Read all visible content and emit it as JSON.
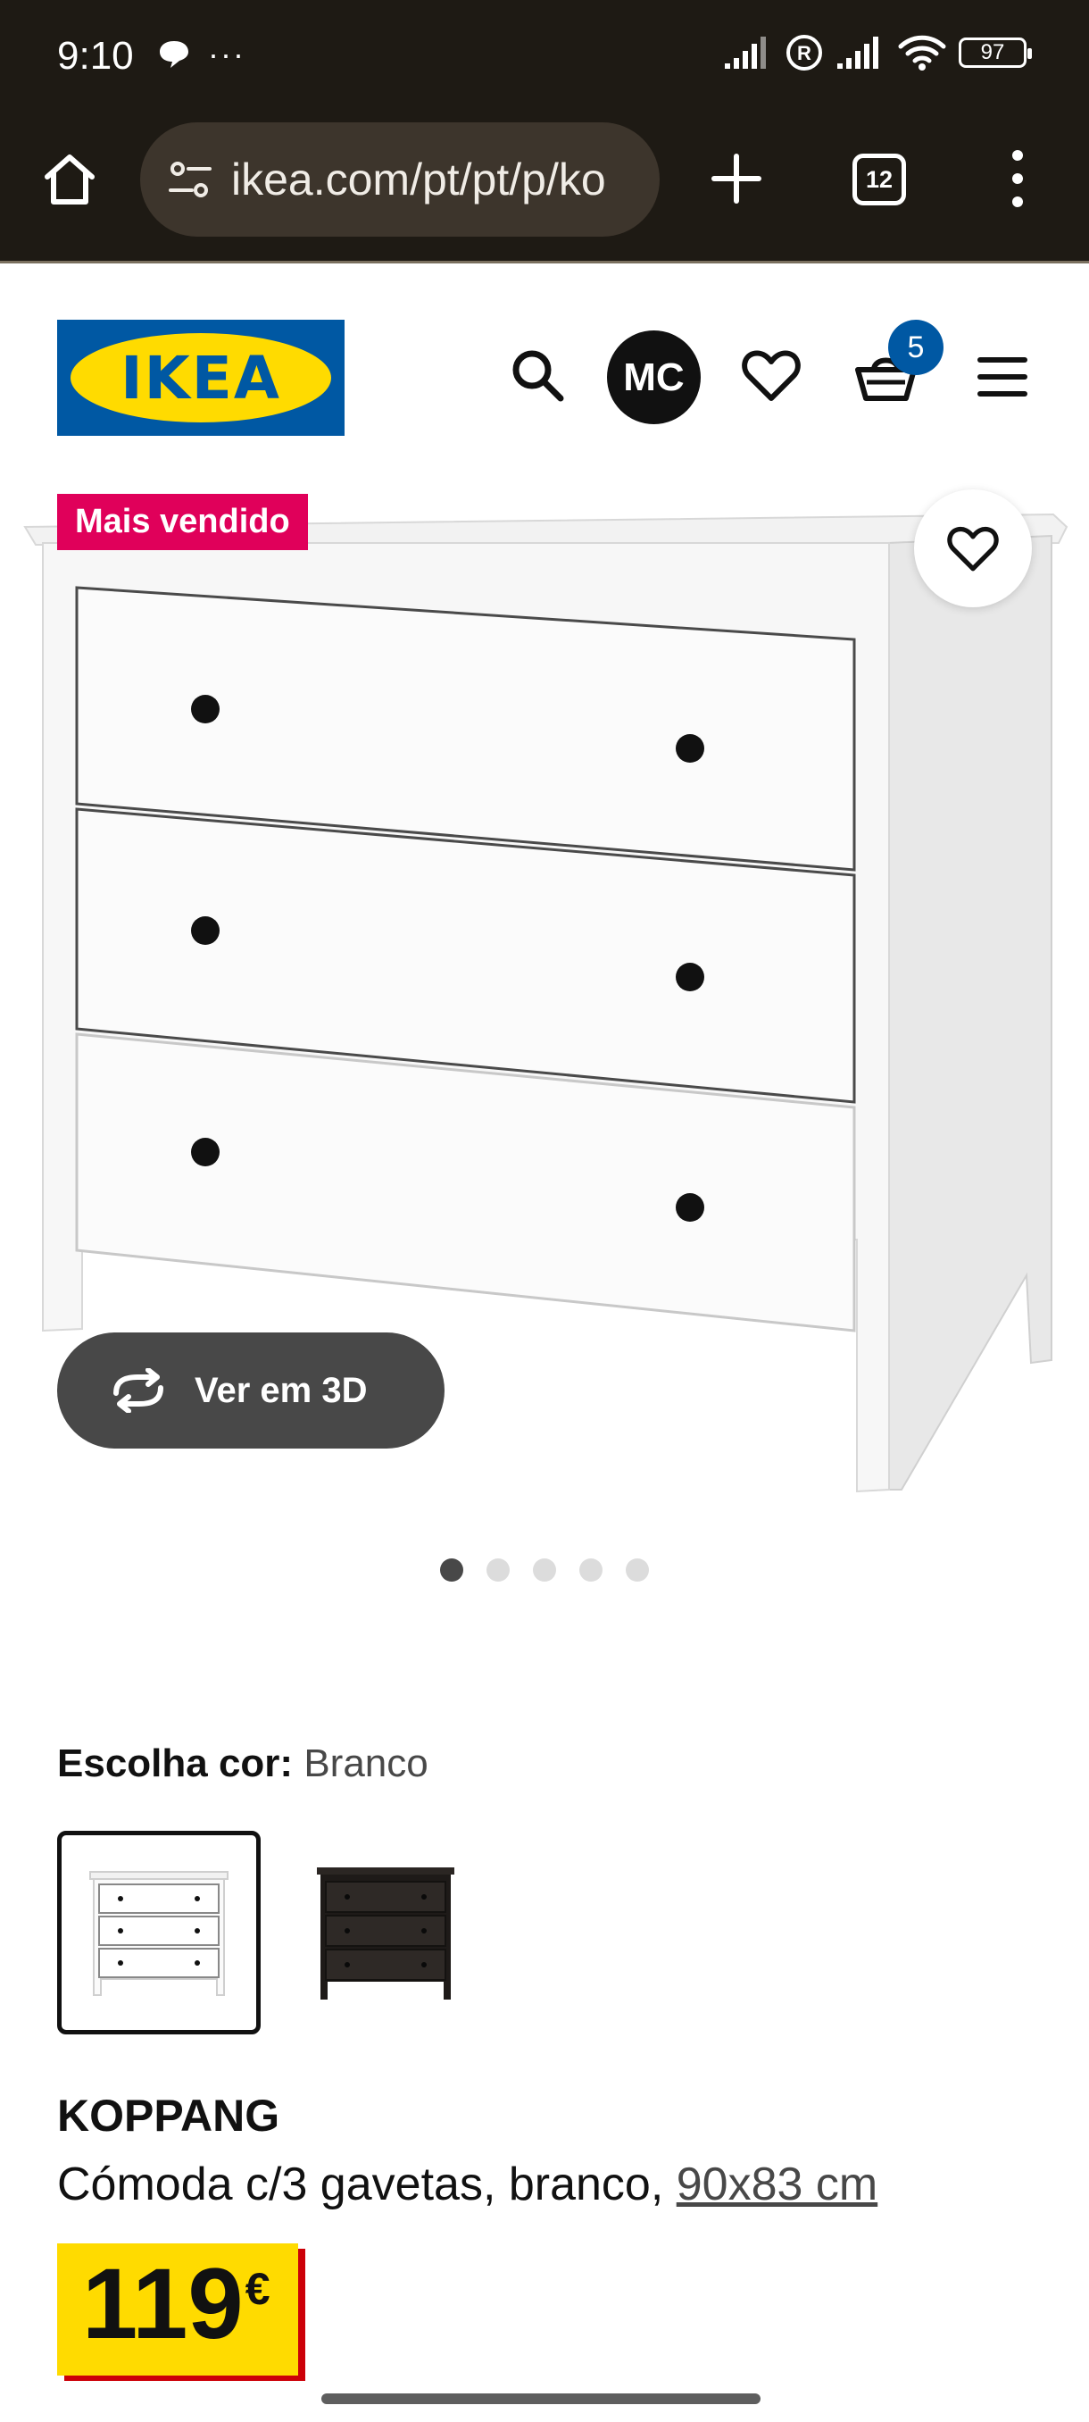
{
  "status_bar": {
    "time": "9:10",
    "extra": "···",
    "battery": "97"
  },
  "browser": {
    "url": "ikea.com/pt/pt/p/ko",
    "tabs_count": "12"
  },
  "header": {
    "logo_text": "IKEA",
    "avatar_initials": "MC",
    "cart_count": "5"
  },
  "product_image": {
    "badge": "Mais vendido",
    "view3d_label": "Ver em 3D",
    "carousel": {
      "count": 5,
      "active_index": 0
    }
  },
  "color": {
    "label": "Escolha cor:",
    "value": "Branco",
    "options": [
      {
        "name": "white-swatch",
        "color": "#ffffff",
        "selected": true
      },
      {
        "name": "black-swatch",
        "color": "#2b2623",
        "selected": false
      }
    ]
  },
  "product": {
    "name": "KOPPANG",
    "description": "Cómoda c/3 gavetas, branco, ",
    "dimensions": "90x83 cm",
    "price": "119",
    "currency": "€"
  },
  "colors": {
    "ikea_blue": "#0058a3",
    "ikea_yellow": "#ffdb00",
    "badge_pink": "#e0005a",
    "price_red": "#cc0008"
  }
}
